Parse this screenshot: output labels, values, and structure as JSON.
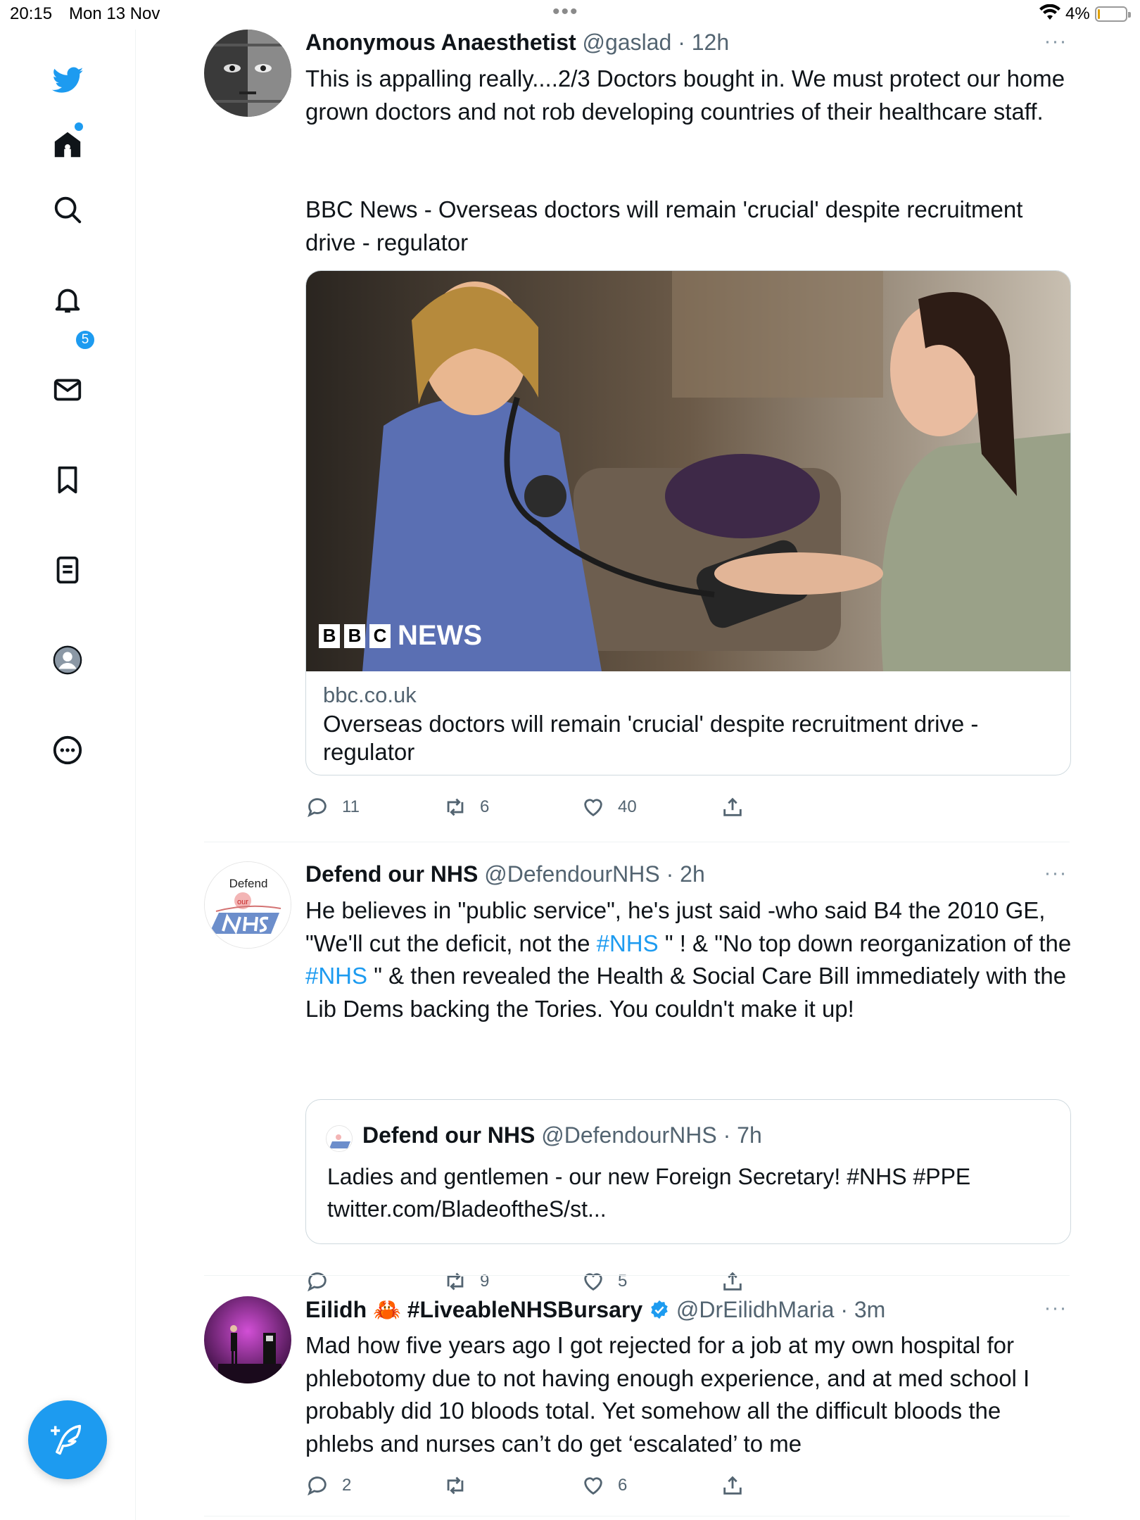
{
  "status_bar": {
    "time": "20:15",
    "date": "Mon 13 Nov",
    "battery": "4%"
  },
  "sidebar": {
    "items": [
      {
        "icon": "twitter-bird-icon"
      },
      {
        "icon": "home-icon"
      },
      {
        "icon": "search-icon"
      },
      {
        "icon": "notifications-bell-icon",
        "badge": "5"
      },
      {
        "icon": "messages-envelope-icon"
      },
      {
        "icon": "bookmark-icon"
      },
      {
        "icon": "lists-icon"
      },
      {
        "icon": "profile-icon"
      },
      {
        "icon": "more-circle-icon"
      }
    ],
    "compose_icon": "compose-tweet-icon",
    "accent": "#1d9bf0"
  },
  "tweets": [
    {
      "name": "Anonymous Anaesthetist",
      "handle": "@gaslad",
      "time": "12h",
      "text_1": "This is appalling really....2/3 Doctors bought in. We must protect our home grown doctors and not rob developing countries of their healthcare staff.",
      "text_2": "BBC News - Overseas doctors will remain 'crucial' despite recruitment drive - regulator",
      "card": {
        "image_logo": "NEWS",
        "domain": "bbc.co.uk",
        "title": "Overseas doctors will remain 'crucial' despite recruitment drive - regulator"
      },
      "replies": "11",
      "retweets": "6",
      "likes": "40"
    },
    {
      "name": "Defend our NHS",
      "handle": "@DefendourNHS",
      "time": "2h",
      "avatar_text": "Defend",
      "text_parts": {
        "a": "He believes in \"public service\", he's just said -who said B4 the 2010 GE, \"We'll cut the deficit, not the ",
        "tag1": "#NHS",
        "b": " \" ! & \"No top down reorganization of the ",
        "tag2": "#NHS",
        "c": " \" & then revealed the Health & Social Care Bill immediately with the Lib Dems backing the Tories. You couldn't make it up!"
      },
      "quote": {
        "name": "Defend our NHS",
        "handle": "@DefendourNHS",
        "time": "7h",
        "text": "Ladies and gentlemen - our new Foreign Secretary! #NHS  #PPE twitter.com/BladeoftheS/st..."
      },
      "replies": "",
      "retweets": "9",
      "likes": "5"
    },
    {
      "name": "Eilidh 🦀 #LiveableNHSBursary",
      "handle": "@DrEilidhMaria",
      "time": "3m",
      "verified": true,
      "text": "Mad how five years ago I got rejected for a job at my own hospital for phlebotomy due to not having enough experience, and at med school I probably did 10 bloods total. Yet somehow all the difficult bloods the phlebs and nurses can’t do get ‘escalated’ to  me",
      "replies": "2",
      "retweets": "",
      "likes": "6"
    }
  ]
}
